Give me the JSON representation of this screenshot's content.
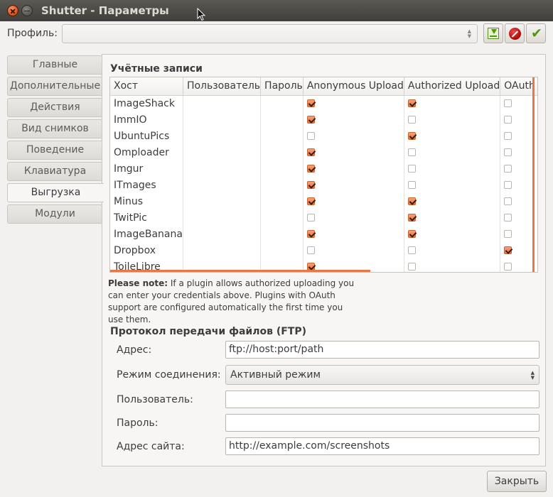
{
  "window": {
    "title": "Shutter - Параметры"
  },
  "profile": {
    "label": "Профиль:",
    "value": ""
  },
  "sidebar": {
    "tabs": [
      {
        "label": "Главные"
      },
      {
        "label": "Дополнительные"
      },
      {
        "label": "Действия"
      },
      {
        "label": "Вид снимков"
      },
      {
        "label": "Поведение"
      },
      {
        "label": "Клавиатура"
      },
      {
        "label": "Выгрузка",
        "active": true
      },
      {
        "label": "Модули"
      }
    ]
  },
  "accounts": {
    "title": "Учётные записи",
    "columns": [
      "Хост",
      "Пользователь",
      "Пароль",
      "Anonymous Upload",
      "Authorized Upload",
      "OAuth Upload"
    ],
    "rows": [
      {
        "host": "ImageShack",
        "user": "",
        "password": "",
        "anonymous": true,
        "authorized": true,
        "oauth": false
      },
      {
        "host": "ImmIO",
        "user": "",
        "password": "",
        "anonymous": true,
        "authorized": false,
        "oauth": false
      },
      {
        "host": "UbuntuPics",
        "user": "",
        "password": "",
        "anonymous": false,
        "authorized": true,
        "oauth": false
      },
      {
        "host": "Omploader",
        "user": "",
        "password": "",
        "anonymous": true,
        "authorized": false,
        "oauth": false
      },
      {
        "host": "Imgur",
        "user": "",
        "password": "",
        "anonymous": true,
        "authorized": false,
        "oauth": false
      },
      {
        "host": "ITmages",
        "user": "",
        "password": "",
        "anonymous": true,
        "authorized": false,
        "oauth": false
      },
      {
        "host": "Minus",
        "user": "",
        "password": "",
        "anonymous": true,
        "authorized": true,
        "oauth": false
      },
      {
        "host": "TwitPic",
        "user": "",
        "password": "",
        "anonymous": false,
        "authorized": true,
        "oauth": false
      },
      {
        "host": "ImageBanana",
        "user": "",
        "password": "",
        "anonymous": true,
        "authorized": true,
        "oauth": false
      },
      {
        "host": "Dropbox",
        "user": "",
        "password": "",
        "anonymous": false,
        "authorized": false,
        "oauth": true
      },
      {
        "host": "ToileLibre",
        "user": "",
        "password": "",
        "anonymous": true,
        "authorized": false,
        "oauth": false
      }
    ],
    "note_bold": "Please note:",
    "note_text": " If a plugin allows authorized uploading you can enter your credentials above. Plugins with OAuth support are configured automatically the first time you use them."
  },
  "ftp": {
    "title": "Протокол передачи файлов (FTP)",
    "address_label": "Адрес:",
    "address_value": "ftp://host:port/path",
    "mode_label": "Режим соединения:",
    "mode_value": "Активный режим",
    "user_label": "Пользователь:",
    "user_value": "",
    "password_label": "Пароль:",
    "password_value": "",
    "site_label": "Адрес сайта:",
    "site_value": "http://example.com/screenshots"
  },
  "buttons": {
    "close": "Закрыть"
  },
  "colors": {
    "accent": "#e8733f",
    "titlebar": "#3f3e3a",
    "background": "#f2f1f0"
  }
}
